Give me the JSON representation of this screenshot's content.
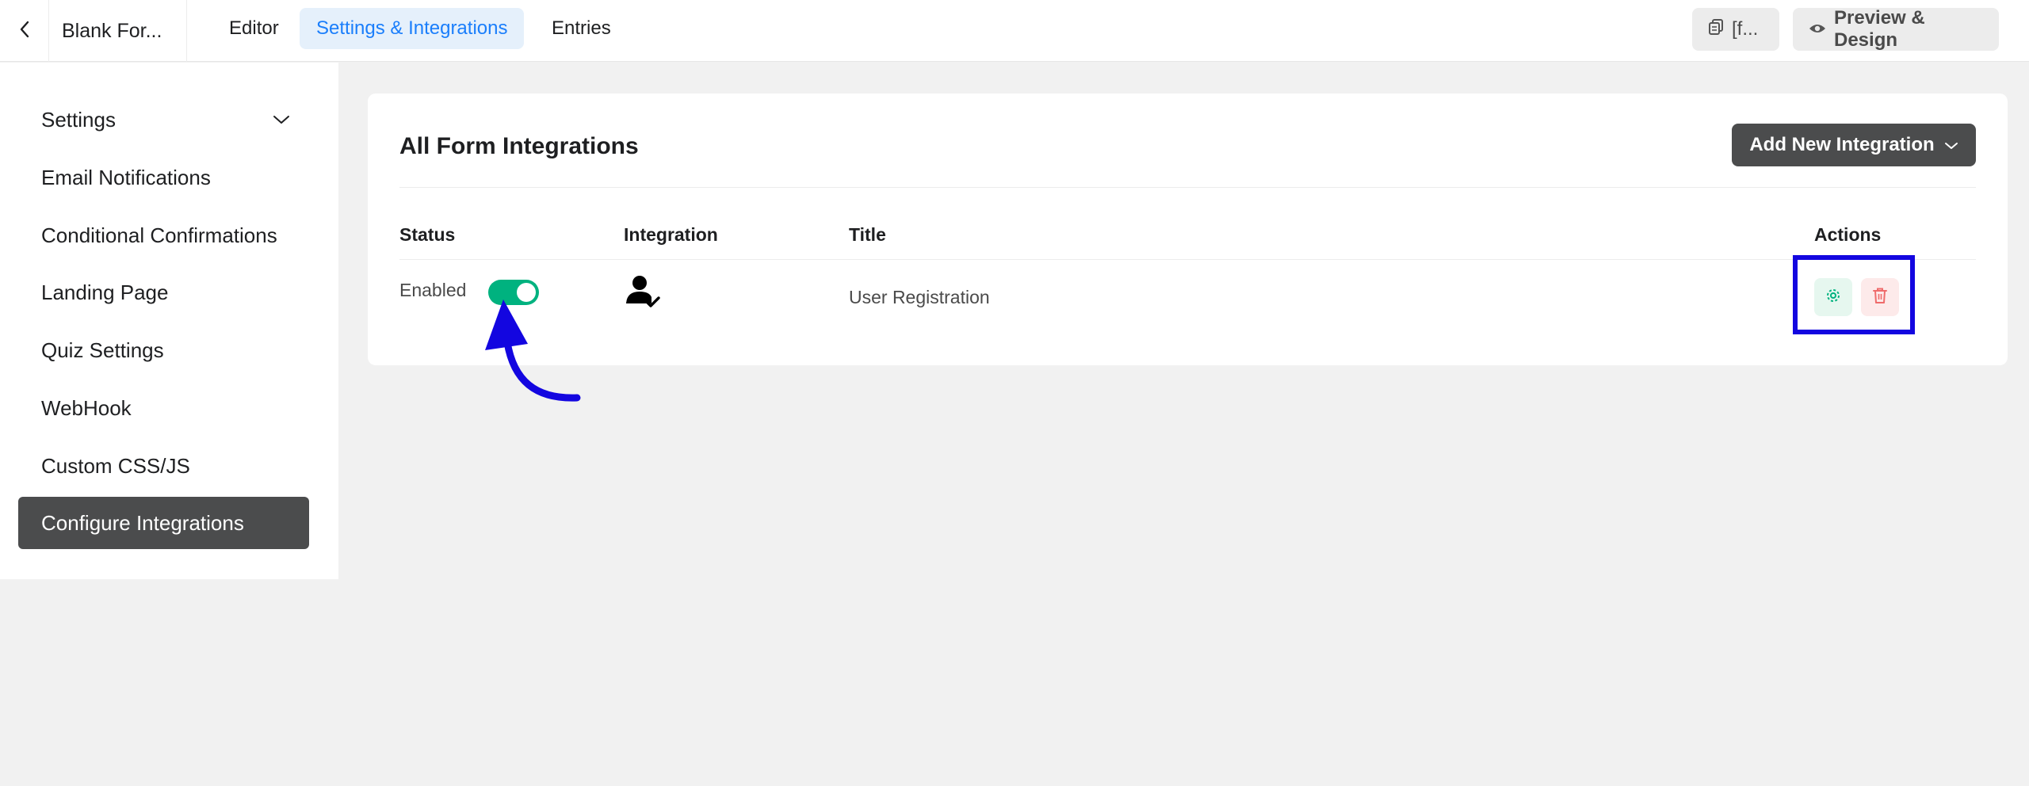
{
  "topbar": {
    "form_name": "Blank For...",
    "tabs": [
      {
        "label": "Editor",
        "active": false
      },
      {
        "label": "Settings & Integrations",
        "active": true
      },
      {
        "label": "Entries",
        "active": false
      }
    ],
    "shortcode_label": "[f...",
    "preview_label": "Preview & Design"
  },
  "sidebar": {
    "items": [
      {
        "label": "Settings",
        "has_chevron": true
      },
      {
        "label": "Email Notifications"
      },
      {
        "label": "Conditional Confirmations"
      },
      {
        "label": "Landing Page"
      },
      {
        "label": "Quiz Settings"
      },
      {
        "label": "WebHook"
      },
      {
        "label": "Custom CSS/JS"
      },
      {
        "label": "Configure Integrations",
        "active": true
      }
    ]
  },
  "main": {
    "title": "All Form Integrations",
    "add_button_label": "Add New Integration",
    "columns": [
      "Status",
      "Integration",
      "Title",
      "Actions"
    ],
    "rows": [
      {
        "status": "Enabled",
        "enabled": true,
        "integration_icon": "user-check-icon",
        "title": "User Registration"
      }
    ]
  },
  "colors": {
    "accent_blue": "#1a7efb",
    "toggle_green": "#00b27f",
    "dark_button": "#4b4c4d",
    "annotation_blue": "#1306e0"
  }
}
